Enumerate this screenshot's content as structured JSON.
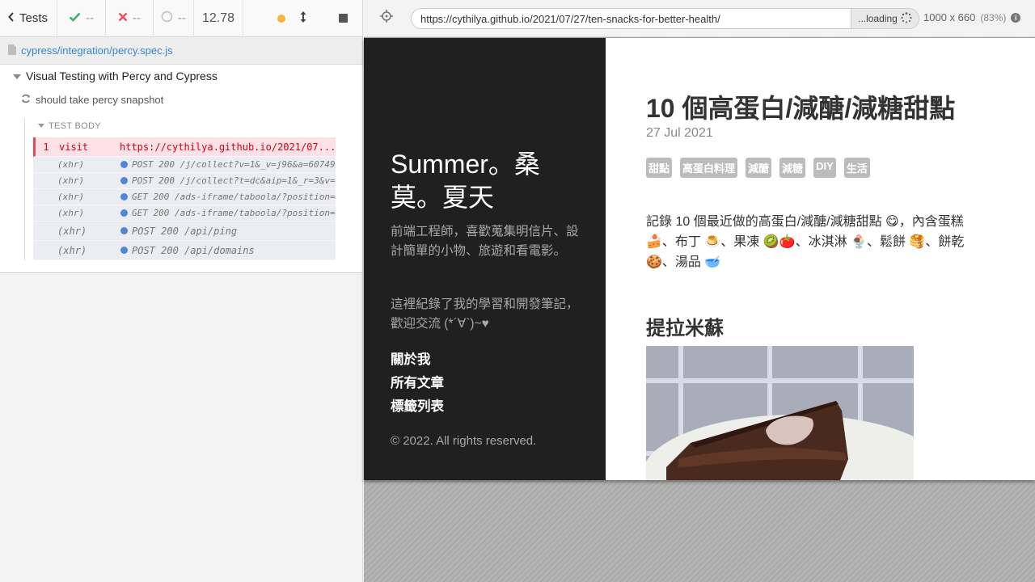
{
  "reporter": {
    "tests_label": "Tests",
    "passed_count": "--",
    "failed_count": "--",
    "pending_count": "--",
    "duration": "12.78",
    "spec_file": "cypress/integration/percy.spec.js",
    "suite_title": "Visual Testing with Percy and Cypress",
    "test_title": "should take percy snapshot",
    "test_body_label": "TEST BODY",
    "commands": [
      {
        "num": "1",
        "name": "visit",
        "message": "https://cythilya.github.io/2021/07..."
      },
      {
        "name": "(xhr)",
        "message": "POST 200 /j/collect?v=1&_v=j96&a=60749..."
      },
      {
        "name": "(xhr)",
        "message": "POST 200 /j/collect?t=dc&aip=1&_r=3&v=..."
      },
      {
        "name": "(xhr)",
        "message": "GET 200 /ads-iframe/taboola/?position=..."
      },
      {
        "name": "(xhr)",
        "message": "GET 200 /ads-iframe/taboola/?position=..."
      },
      {
        "name": "(xhr)",
        "message": "POST 200 /api/ping"
      },
      {
        "name": "(xhr)",
        "message": "POST 200 /api/domains"
      }
    ]
  },
  "aut": {
    "url": "https://cythilya.github.io/2021/07/27/ten-snacks-for-better-health/",
    "loading_label": "...loading",
    "viewport": "1000 x 660",
    "scale": "(83%)"
  },
  "blog": {
    "site_title": "Summer。桑莫。夏天",
    "description": "前端工程師，喜歡蒐集明信片、設計簡單的小物、旅遊和看電影。",
    "description2": "這裡紀錄了我的學習和開發筆記，歡迎交流 (*´∀`)~♥",
    "nav": [
      "關於我",
      "所有文章",
      "標籤列表"
    ],
    "copyright": "© 2022. All rights reserved.",
    "post_title": "10 個高蛋白/減醣/減糖甜點",
    "post_date": "27 Jul 2021",
    "tags": [
      "甜點",
      "高蛋白料理",
      "減醣",
      "減糖",
      "DIY",
      "生活"
    ],
    "intro": "記錄 10 個最近做的高蛋白/減醣/減糖甜點 😋，內含蛋糕 🍰、布丁 🍮、果凍 🥝🍅、冰淇淋 🍨、鬆餅 🥞、餅乾 🍪、湯品 🥣",
    "section_heading": "提拉米蘇"
  }
}
